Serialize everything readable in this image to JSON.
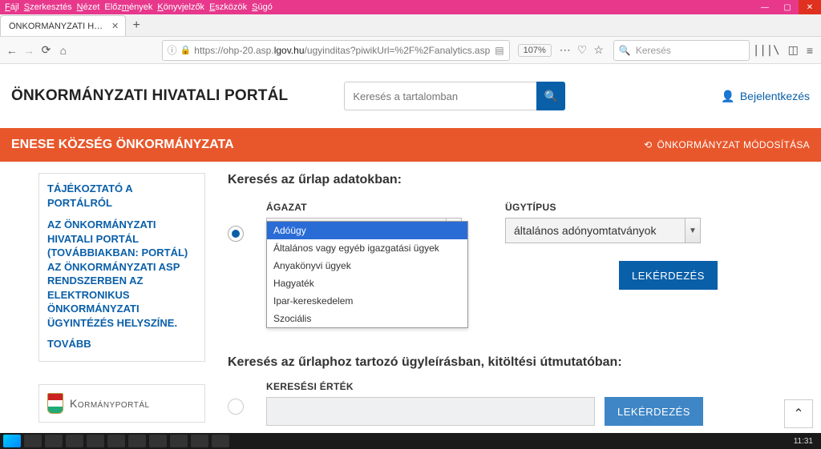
{
  "window": {
    "menus": [
      "Fájl",
      "Szerkesztés",
      "Nézet",
      "Előzmények",
      "Könyvjelzők",
      "Eszközök",
      "Súgó"
    ],
    "tab_title": "ÖNKORMÁNYZATI HIVATALI PORT",
    "url_prefix": "https://ohp-20.asp.",
    "url_host": "lgov.hu",
    "url_rest": "/ugyinditas?piwikUrl=%2F%2Fanalytics.asp",
    "zoom": "107%",
    "search_placeholder": "Keresés"
  },
  "site": {
    "title": "ÖNKORMÁNYZATI HIVATALI PORTÁL",
    "search_placeholder": "Keresés a tartalomban",
    "login_label": "Bejelentkezés"
  },
  "orangebar": {
    "org": "ENESE KÖZSÉG ÖNKORMÁNYZATA",
    "change": "ÖNKORMÁNYZAT MÓDOSÍTÁSA"
  },
  "sidebar": {
    "link1": "TÁJÉKOZTATÓ A PORTÁLRÓL",
    "link2": "AZ ÖNKORMÁNYZATI HIVATALI PORTÁL (TOVÁBBIAKBAN: PORTÁL) AZ ÖNKORMÁNYZATI ASP RENDSZERBEN AZ ELEKTRONIKUS ÖNKORMÁNYZATI ÜGYINTÉZÉS HELYSZÍNE.",
    "more": "TOVÁBB",
    "govportal": "Kormányportál"
  },
  "form": {
    "heading1": "Keresés az űrlap adatokban:",
    "agazat_label": "ÁGAZAT",
    "agazat_value": "Adóügy",
    "agazat_options": [
      "Adóügy",
      "Általános vagy egyéb igazgatási ügyek",
      "Anyakönyvi ügyek",
      "Hagyaték",
      "Ipar-kereskedelem",
      "Szociális"
    ],
    "ugytipus_label": "ÜGYTÍPUS",
    "ugytipus_value": "általános adónyomtatványok",
    "btn_query": "LEKÉRDEZÉS",
    "heading2": "Keresés az űrlaphoz tartozó ügyleírásban, kitöltési útmutatóban:",
    "search_label": "KERESÉSI ÉRTÉK",
    "btn_query2": "LEKÉRDEZÉS"
  },
  "taskbar": {
    "clock": "11:31"
  }
}
